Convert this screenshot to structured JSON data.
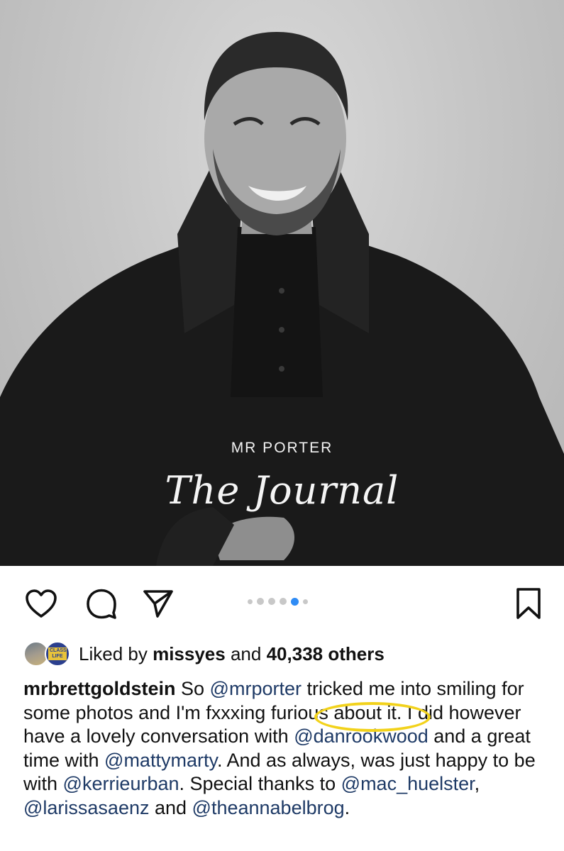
{
  "post": {
    "image_overlay": {
      "brand_name": "MR PORTER",
      "brand_script": "The Journal"
    },
    "carousel": {
      "total": 6,
      "active_index": 3
    },
    "likes": {
      "prefix": "Liked by",
      "first_user": "missyes",
      "joiner": "and",
      "count_text": "40,338 others",
      "avatar2_badge": "CLASSIC LIFE"
    },
    "caption": {
      "username": "mrbrettgoldstein",
      "t1": " So ",
      "m1": "@mrporter",
      "t2": " tricked me into smiling for some photos and I'm fxxxing furious about it. I did however have a lovely conversation with ",
      "m2": "@danrookwood",
      "t3": " and a great time with ",
      "m3": "@mattymarty",
      "t4": ". And as always, was just happy to be with ",
      "m4": "@kerrieurban",
      "t5": ". Special thanks to ",
      "m5": "@mac_huelster",
      "t6": ", ",
      "m6": "@larissasaenz",
      "t7": " and ",
      "m7": "@theannabelbrog",
      "t8": "."
    }
  },
  "colors": {
    "mention": "#1e3a66",
    "active_dot": "#2f8cf5",
    "highlight_ring": "#f2d21b"
  },
  "icons": [
    "heart-icon",
    "comment-icon",
    "share-icon",
    "bookmark-icon"
  ]
}
